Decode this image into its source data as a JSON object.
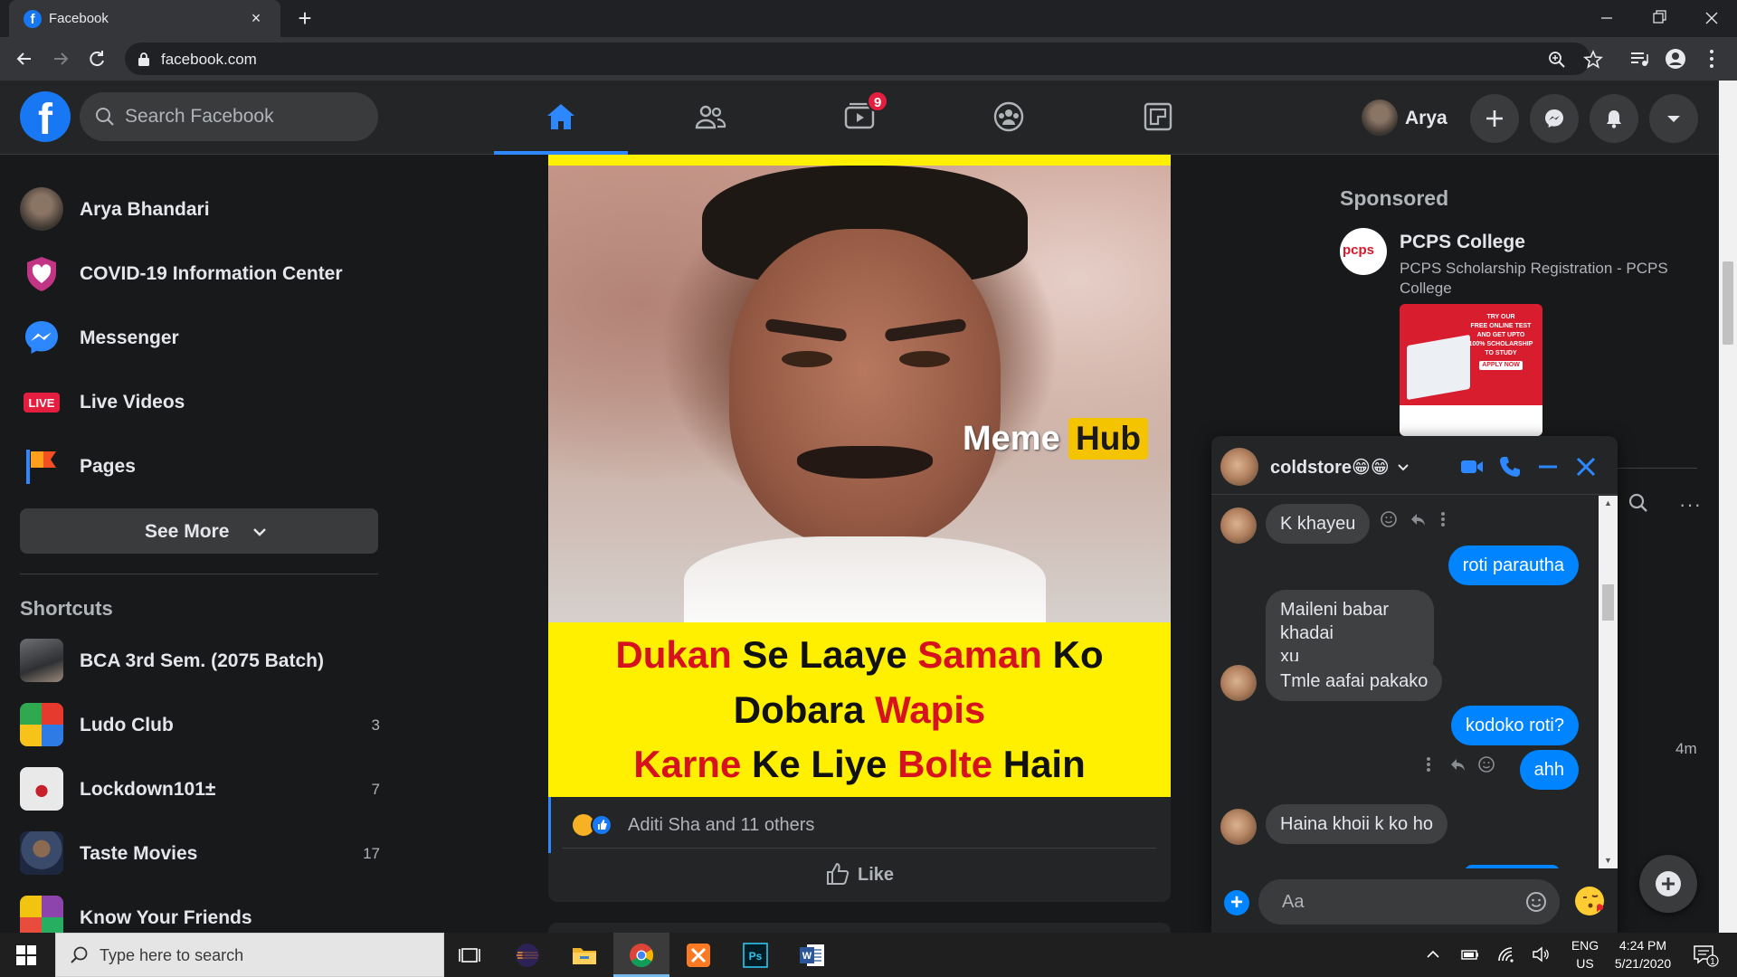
{
  "browser": {
    "tab_title": "Facebook",
    "tab_close": "×",
    "new_tab": "+",
    "url": "facebook.com"
  },
  "header": {
    "logo": "f",
    "search_placeholder": "Search Facebook",
    "watch_badge": "9",
    "user_name": "Arya",
    "nav_tabs": [
      "home",
      "friends",
      "watch",
      "groups",
      "gaming"
    ]
  },
  "sidebar": {
    "items": [
      {
        "label": "Arya Bhandari",
        "icon": "profile-avatar"
      },
      {
        "label": "COVID-19 Information Center",
        "icon": "covid-heart-icon"
      },
      {
        "label": "Messenger",
        "icon": "messenger-icon"
      },
      {
        "label": "Live Videos",
        "icon": "live-icon",
        "icon_text": "LIVE"
      },
      {
        "label": "Pages",
        "icon": "pages-flag-icon"
      }
    ],
    "see_more": "See More",
    "shortcuts_title": "Shortcuts",
    "shortcuts": [
      {
        "label": "BCA 3rd Sem. (2075 Batch)",
        "count": ""
      },
      {
        "label": "Ludo Club",
        "count": "3"
      },
      {
        "label": "Lockdown101±",
        "count": "7"
      },
      {
        "label": "Taste Movies",
        "count": "17"
      },
      {
        "label": "Know Your Friends",
        "count": ""
      }
    ]
  },
  "post": {
    "watermark_meme": "Meme",
    "watermark_hub": "Hub",
    "caption_lines": [
      [
        {
          "t": "Dukan",
          "red": true
        },
        {
          "t": " Se Laaye ",
          "red": false
        },
        {
          "t": "Saman",
          "red": true
        },
        {
          "t": " Ko",
          "red": false
        }
      ],
      [
        {
          "t": "Dobara ",
          "red": false
        },
        {
          "t": "Wapis",
          "red": true
        }
      ],
      [
        {
          "t": "Karne",
          "red": true
        },
        {
          "t": " Ke Liye ",
          "red": false
        },
        {
          "t": "Bolte",
          "red": true
        },
        {
          "t": " Hain",
          "red": false
        }
      ]
    ],
    "reactions_text": "Aditi Sha and 11 others",
    "like_label": "Like"
  },
  "sponsored": {
    "heading": "Sponsored",
    "logo_text": "pcps",
    "ad_name": "PCPS College",
    "ad_desc": "PCPS Scholarship Registration - PCPS College",
    "ad_img_lines": [
      "TRY OUR",
      "FREE ONLINE TEST",
      "AND GET UPTO",
      "100% SCHOLARSHIP",
      "TO STUDY"
    ],
    "ad_cta": "APPLY NOW",
    "time": "4m",
    "more": "···"
  },
  "chat": {
    "name": "coldstore😁😁",
    "input_placeholder": "Aa",
    "messages": [
      {
        "from": "them",
        "text": "K khayeu"
      },
      {
        "from": "me",
        "text": "roti parautha"
      },
      {
        "from": "them",
        "text": "Maileni babar khadai\nxu"
      },
      {
        "from": "them",
        "text": "Tmle aafai pakako"
      },
      {
        "from": "me",
        "text": "kodoko roti?"
      },
      {
        "from": "me",
        "text": "ahh"
      },
      {
        "from": "them",
        "text": "Haina khoii k ko ho"
      }
    ]
  },
  "taskbar": {
    "search_placeholder": "Type here to search",
    "lang_top": "ENG",
    "lang_bottom": "US",
    "time": "4:24 PM",
    "date": "5/21/2020",
    "notif_count": "1",
    "apps": [
      "task-view",
      "eclipse",
      "file-explorer",
      "chrome",
      "xampp",
      "photoshop",
      "word"
    ]
  },
  "colors": {
    "fb_blue": "#1877f2",
    "messenger_blue": "#0084ff",
    "meme_yellow": "#fff000",
    "meme_red": "#d6121e",
    "badge_red": "#e41e3f"
  }
}
